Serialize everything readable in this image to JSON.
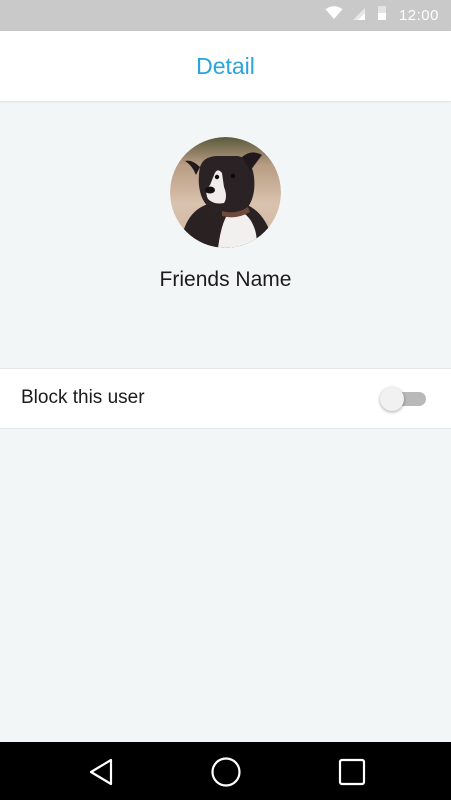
{
  "status_bar": {
    "time": "12:00",
    "icons": [
      "wifi-icon",
      "signal-icon",
      "battery-icon"
    ],
    "background": "#c9c9c9"
  },
  "app_bar": {
    "title": "Detail",
    "title_color": "#2aa4d9"
  },
  "profile": {
    "name": "Friends Name",
    "avatar_icon": "dog-photo-avatar"
  },
  "block_setting": {
    "label": "Block this user",
    "enabled": false
  },
  "nav_bar": {
    "buttons": [
      "back-icon",
      "home-icon",
      "recents-icon"
    ]
  }
}
